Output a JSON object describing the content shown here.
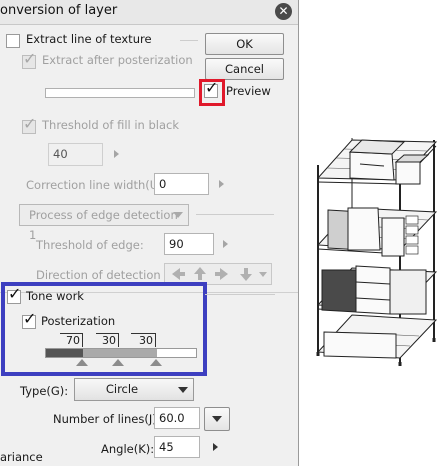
{
  "dialog": {
    "title": "onversion of layer",
    "extract_line_texture": "Extract line of texture",
    "extract_after_posterization": "Extract after posterization",
    "ok_label": "OK",
    "cancel_label": "Cancel",
    "preview_label": "Preview",
    "threshold_fill_label": "Threshold of fill in black",
    "threshold_fill_value": "40",
    "correction_label": "Correction line width(U):",
    "correction_value": "0",
    "edge_process_label": "Process of edge detection 1",
    "threshold_edge_label": "Threshold of edge:",
    "threshold_edge_value": "90",
    "direction_label": "Direction of detection",
    "tone_work_label": "Tone work",
    "posterization_label": "Posterization",
    "poster_values": [
      "70",
      "30",
      "30"
    ],
    "type_label": "Type(G):",
    "type_value": "Circle",
    "lines_label": "Number of lines(J):",
    "lines_value": "60.0",
    "angle_label": "Angle(K):",
    "angle_value": "45",
    "variance_label": "ariance"
  },
  "colors": {
    "highlight_red": "#e0192b",
    "highlight_blue": "#3d3fc0"
  },
  "icons": [
    "close-icon",
    "check-icon",
    "arrow-left-icon",
    "arrow-up-icon",
    "arrow-right-icon",
    "arrow-down-icon",
    "chevron-down-icon"
  ]
}
